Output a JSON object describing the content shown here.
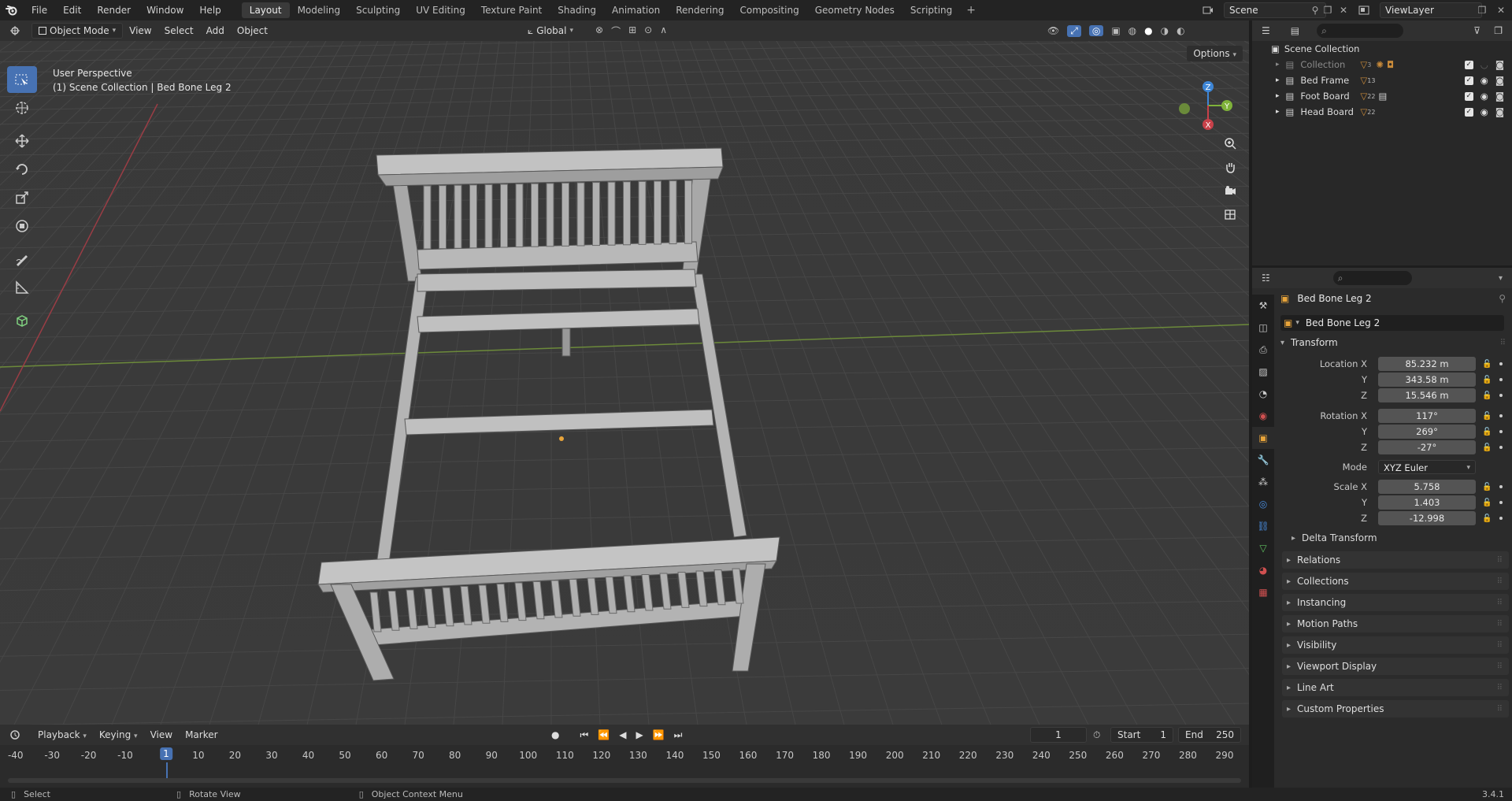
{
  "topbar": {
    "menus": [
      "File",
      "Edit",
      "Render",
      "Window",
      "Help"
    ],
    "workspaces": [
      "Layout",
      "Modeling",
      "Sculpting",
      "UV Editing",
      "Texture Paint",
      "Shading",
      "Animation",
      "Rendering",
      "Compositing",
      "Geometry Nodes",
      "Scripting"
    ],
    "active_workspace": "Layout",
    "scene_name": "Scene",
    "view_layer": "ViewLayer"
  },
  "viewport_header": {
    "mode": "Object Mode",
    "menus": [
      "View",
      "Select",
      "Add",
      "Object"
    ],
    "orientation": "Global",
    "options_label": "Options"
  },
  "viewport": {
    "perspective_label": "User Perspective",
    "context_label": "(1) Scene Collection | Bed Bone Leg 2",
    "gizmo": {
      "x": "X",
      "y": "Y",
      "z": "Z"
    }
  },
  "timeline": {
    "menus": [
      "Playback",
      "Keying",
      "View",
      "Marker"
    ],
    "current_frame": "1",
    "start_label": "Start",
    "start_value": "1",
    "end_label": "End",
    "end_value": "250",
    "ruler": [
      "-40",
      "-30",
      "-20",
      "-10",
      "1",
      "10",
      "20",
      "30",
      "40",
      "50",
      "60",
      "70",
      "80",
      "90",
      "100",
      "110",
      "120",
      "130",
      "140",
      "150",
      "160",
      "170",
      "180",
      "190",
      "200",
      "210",
      "220",
      "230",
      "240",
      "250",
      "260",
      "270",
      "280",
      "290"
    ]
  },
  "statusbar": {
    "select": "Select",
    "rotate": "Rotate View",
    "context": "Object Context Menu",
    "version": "3.4.1"
  },
  "outliner": {
    "root": "Scene Collection",
    "items": [
      {
        "name": "Collection",
        "badge": "3",
        "dim": true
      },
      {
        "name": "Bed Frame",
        "badge": "13",
        "dim": false
      },
      {
        "name": "Foot Board",
        "badge": "22",
        "dim": false
      },
      {
        "name": "Head Board",
        "badge": "22",
        "dim": false
      }
    ]
  },
  "properties": {
    "object_name": "Bed Bone Leg 2",
    "data_name": "Bed Bone Leg 2",
    "transform_label": "Transform",
    "location": {
      "label": "Location X",
      "x": "85.232 m",
      "y": "343.58 m",
      "z": "15.546 m"
    },
    "rotation": {
      "label": "Rotation X",
      "x": "117°",
      "y": "269°",
      "z": "-27°"
    },
    "mode_label": "Mode",
    "mode_value": "XYZ Euler",
    "scale": {
      "label": "Scale X",
      "x": "5.758",
      "y": "1.403",
      "z": "-12.998"
    },
    "axis_y": "Y",
    "axis_z": "Z",
    "delta_transform": "Delta Transform",
    "panels": [
      "Relations",
      "Collections",
      "Instancing",
      "Motion Paths",
      "Visibility",
      "Viewport Display",
      "Line Art",
      "Custom Properties"
    ]
  },
  "colors": {
    "accent": "#4772b3",
    "x_axis": "#c8414a",
    "y_axis": "#7fb23a",
    "z_axis": "#3e86d6"
  }
}
